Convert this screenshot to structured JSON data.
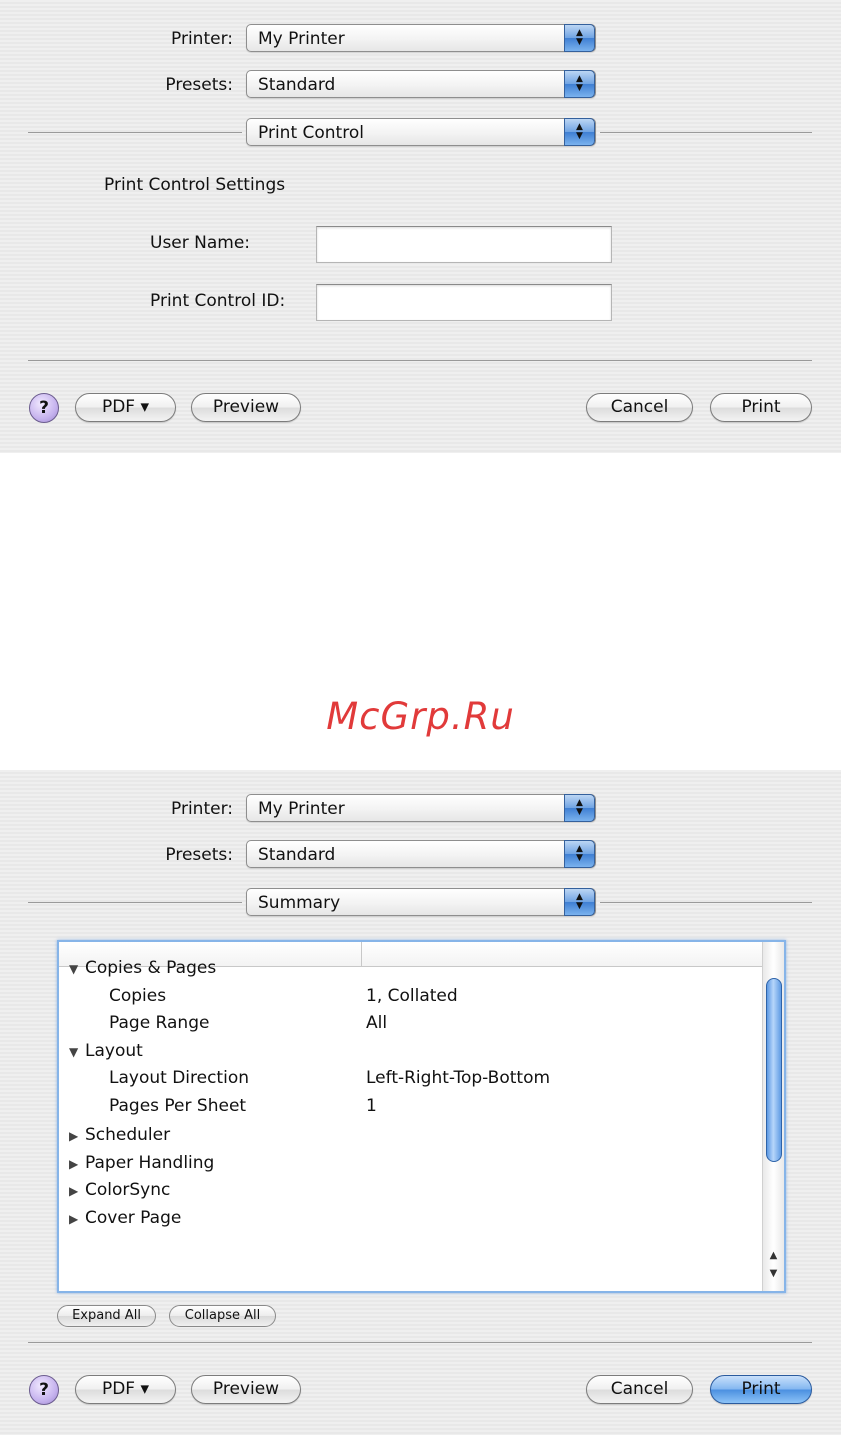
{
  "top_dialog": {
    "printer_label": "Printer:",
    "printer_value": "My Printer",
    "presets_label": "Presets:",
    "presets_value": "Standard",
    "pane_value": "Print Control",
    "section_title": "Print Control Settings",
    "user_name_label": "User Name:",
    "user_name_value": "",
    "print_control_id_label": "Print Control ID:",
    "print_control_id_value": "",
    "help_label": "?",
    "pdf_label": "PDF ▾",
    "preview_label": "Preview",
    "cancel_label": "Cancel",
    "print_label": "Print"
  },
  "watermark": "McGrp.Ru",
  "bottom_dialog": {
    "printer_label": "Printer:",
    "printer_value": "My Printer",
    "presets_label": "Presets:",
    "presets_value": "Standard",
    "pane_value": "Summary",
    "summary": [
      {
        "label": "Copies & Pages",
        "value": "",
        "level": 0,
        "expanded": true
      },
      {
        "label": "Copies",
        "value": "1, Collated",
        "level": 1
      },
      {
        "label": "Page Range",
        "value": "All",
        "level": 1
      },
      {
        "label": "Layout",
        "value": "",
        "level": 0,
        "expanded": true
      },
      {
        "label": "Layout Direction",
        "value": "Left-Right-Top-Bottom",
        "level": 1
      },
      {
        "label": "Pages Per Sheet",
        "value": "1",
        "level": 1
      },
      {
        "label": "Scheduler",
        "value": "",
        "level": 0,
        "expanded": false
      },
      {
        "label": "Paper Handling",
        "value": "",
        "level": 0,
        "expanded": false
      },
      {
        "label": "ColorSync",
        "value": "",
        "level": 0,
        "expanded": false
      },
      {
        "label": "Cover Page",
        "value": "",
        "level": 0,
        "expanded": false
      }
    ],
    "expand_all_label": "Expand All",
    "collapse_all_label": "Collapse All",
    "help_label": "?",
    "pdf_label": "PDF ▾",
    "preview_label": "Preview",
    "cancel_label": "Cancel",
    "print_label": "Print"
  }
}
